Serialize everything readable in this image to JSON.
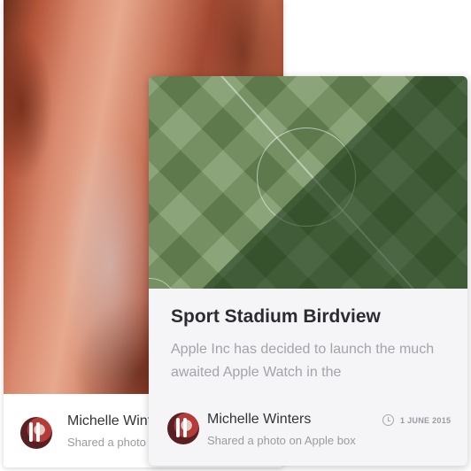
{
  "back_card": {
    "author_name": "Michelle Wint",
    "shared_text": "Shared a photo"
  },
  "front_card": {
    "title": "Sport Stadium Birdview",
    "excerpt": "Apple Inc has decided to launch the much awaited Apple Watch in the",
    "author_name": "Michelle Winters",
    "shared_text": "Shared a photo on Apple box",
    "date": "1 JUNE 2015"
  },
  "icons": {
    "clock": "clock-icon"
  },
  "colors": {
    "title": "#2b2b30",
    "muted": "#a3a3aa",
    "card_bg": "#f5f5f7"
  }
}
